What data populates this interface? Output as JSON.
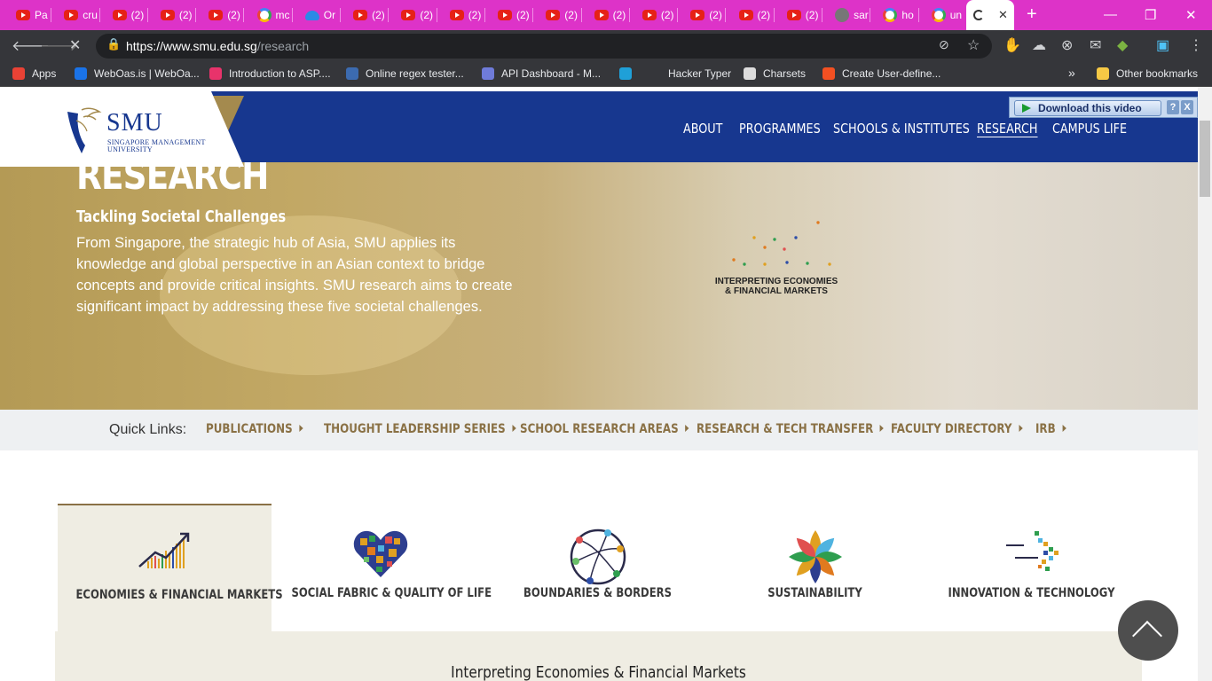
{
  "browser": {
    "tabs": [
      {
        "icon": "youtube-icon",
        "title": "Pa"
      },
      {
        "icon": "youtube-icon",
        "title": "cru"
      },
      {
        "icon": "youtube-icon",
        "title": "(2)"
      },
      {
        "icon": "youtube-icon",
        "title": "(2)"
      },
      {
        "icon": "youtube-icon",
        "title": "(2)"
      },
      {
        "icon": "google-icon",
        "title": "mc"
      },
      {
        "icon": "onedrive-icon",
        "title": "Or"
      },
      {
        "icon": "youtube-icon",
        "title": "(2)"
      },
      {
        "icon": "youtube-icon",
        "title": "(2)"
      },
      {
        "icon": "youtube-icon",
        "title": "(2)"
      },
      {
        "icon": "youtube-icon",
        "title": "(2)"
      },
      {
        "icon": "youtube-icon",
        "title": "(2)"
      },
      {
        "icon": "youtube-icon",
        "title": "(2)"
      },
      {
        "icon": "youtube-icon",
        "title": "(2)"
      },
      {
        "icon": "youtube-icon",
        "title": "(2)"
      },
      {
        "icon": "youtube-icon",
        "title": "(2)"
      },
      {
        "icon": "youtube-icon",
        "title": "(2)"
      },
      {
        "icon": "globe-icon",
        "title": "sar"
      },
      {
        "icon": "google-icon",
        "title": "ho"
      },
      {
        "icon": "google-icon",
        "title": "un"
      }
    ],
    "url_host": "https://www.smu.edu.sg",
    "url_path": "/research",
    "bookmarks": [
      {
        "icon": "apps-grid-icon",
        "label": "Apps",
        "color": "#e94235"
      },
      {
        "icon": "weboas-icon",
        "label": "WebOas.is | WebOa...",
        "color": "#1a73e8"
      },
      {
        "icon": "asp-icon",
        "label": "Introduction to ASP....",
        "color": "#e8336b"
      },
      {
        "icon": "regex-icon",
        "label": "Online regex tester...",
        "color": "#3c6bb0"
      },
      {
        "icon": "api-icon",
        "label": "API Dashboard - M...",
        "color": "#6f7bd9"
      },
      {
        "icon": "jetbrains-icon",
        "label": "",
        "color": "#1fa0d8"
      },
      {
        "icon": "blank-icon",
        "label": "Hacker Typer",
        "color": "transparent"
      },
      {
        "icon": "globe-icon",
        "label": "Charsets",
        "color": "#dcdcdc"
      },
      {
        "icon": "microsoft-icon",
        "label": "Create User-define...",
        "color": "#f25022"
      }
    ],
    "other_bookmarks": "Other bookmarks",
    "more": "»"
  },
  "site": {
    "logo_text": "SMU",
    "logo_full_line1": "SINGAPORE MANAGEMENT",
    "logo_full_line2": "UNIVERSITY",
    "nav": [
      "ABOUT",
      "PROGRAMMES",
      "SCHOOLS & INSTITUTES",
      "RESEARCH",
      "CAMPUS LIFE"
    ],
    "download_video": "Download this video",
    "download_help": "?",
    "download_close": "X",
    "hero": {
      "title": "RESEARCH",
      "subtitle": "Tackling Societal Challenges",
      "description": "From Singapore, the strategic hub of Asia, SMU applies its knowledge and global perspective in an Asian context to bridge concepts and provide critical insights. SMU research aims to create significant impact by addressing these five societal challenges.",
      "logo_line1": "INTERPRETING ECONOMIES",
      "logo_line2": "& FINANCIAL MARKETS"
    },
    "quick_links_label": "Quick Links:",
    "quick_links": [
      "PUBLICATIONS",
      "THOUGHT LEADERSHIP SERIES",
      "SCHOOL RESEARCH AREAS",
      "RESEARCH & TECH TRANSFER",
      "FACULTY DIRECTORY",
      "IRB"
    ],
    "categories": [
      "ECONOMIES & FINANCIAL MARKETS",
      "SOCIAL FABRIC & QUALITY OF LIFE",
      "BOUNDARIES & BORDERS",
      "SUSTAINABILITY",
      "INNOVATION & TECHNOLOGY"
    ],
    "detail_title": "Interpreting Economies & Financial Markets",
    "colors": {
      "navy": "#17378f",
      "gold": "#8a7145",
      "tabbar": "#dd33c8"
    }
  }
}
